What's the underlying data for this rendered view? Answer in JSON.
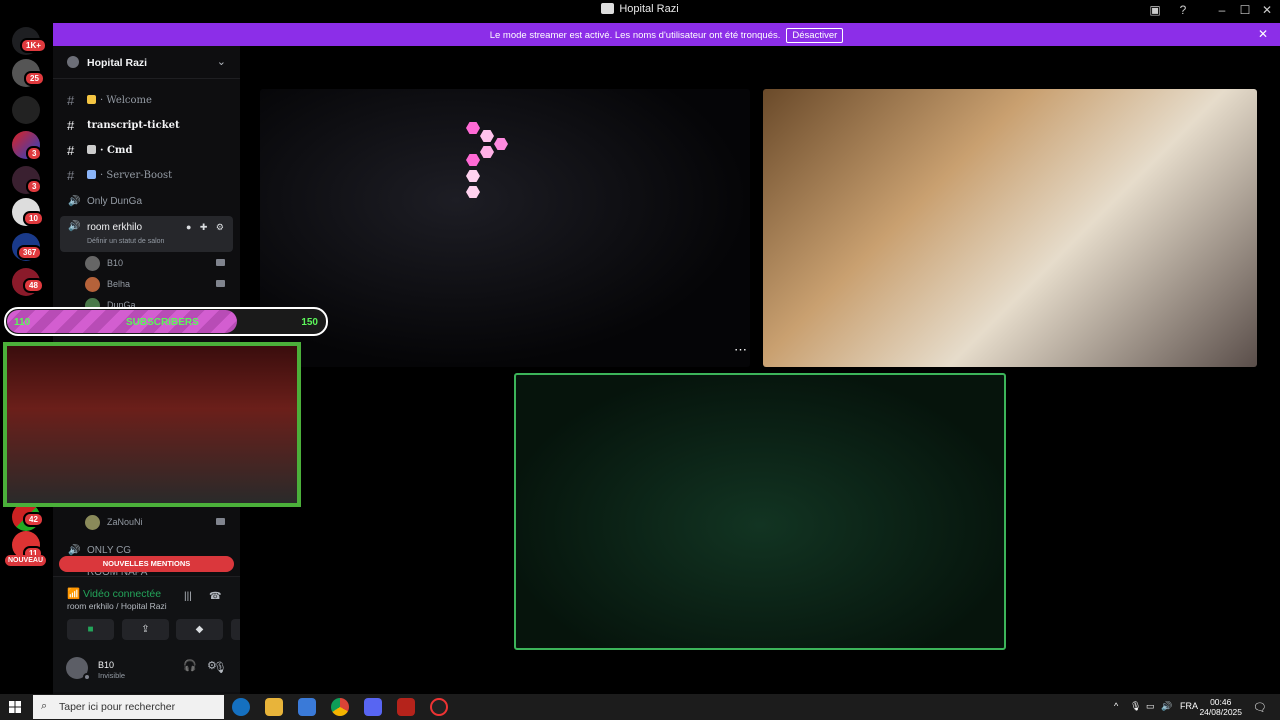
{
  "window": {
    "title": "Hopital Razi"
  },
  "banner": {
    "text": "Le mode streamer est activé. Les noms d'utilisateur ont été tronqués.",
    "button": "Désactiver"
  },
  "rail_badges": [
    "1K+",
    "25",
    "3",
    "3",
    "10",
    "367",
    "48",
    "42",
    "11"
  ],
  "rail_nouveau": "NOUVEAU",
  "server": {
    "name": "Hopital Razi"
  },
  "channels": [
    {
      "label": "· Welcome",
      "bold": false
    },
    {
      "label": "transcript-ticket",
      "bold": true
    },
    {
      "label": "· Cmd",
      "bold": true
    },
    {
      "label": "· Server-Boost",
      "bold": false
    }
  ],
  "voice_channel_1": "Only DunGa",
  "active_voice": {
    "label": "room erkhilo",
    "status": "Définir un statut de salon"
  },
  "members": [
    {
      "name": "B10"
    },
    {
      "name": "Belha"
    },
    {
      "name": "DunGa"
    },
    {
      "name": "ZaNouNi"
    }
  ],
  "voice_channel_2": "ONLY CG",
  "voice_channel_3": "ROOM NAPA",
  "new_mentions": "NOUVELLES MENTIONS",
  "voice_panel": {
    "title": "Vidéo connectée",
    "subtitle": "room erkhilo / Hopital Razi"
  },
  "user": {
    "name": "B10",
    "status": "Invisible"
  },
  "overlay": {
    "left_value": "110",
    "label": "SUBSCRIBERS",
    "right_value": "150",
    "fill_fraction": 0.72
  },
  "taskbar": {
    "search_placeholder": "Taper ici pour rechercher",
    "lang": "FRA",
    "time": "00:46",
    "date": "24/08/2025"
  },
  "colors": {
    "banner": "#8c2ee8",
    "accent_green": "#23a55a",
    "badge_red": "#e03a3e",
    "mention_red": "#da373c",
    "speaking_border": "#3cb45a"
  }
}
